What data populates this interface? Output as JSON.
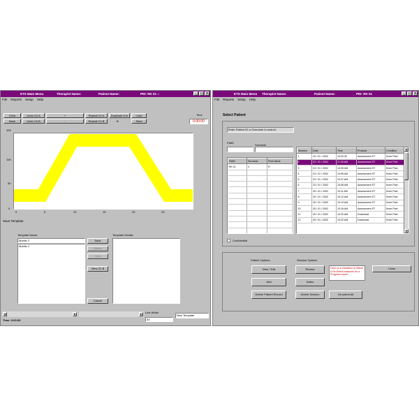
{
  "left_window": {
    "title": "ETS Main Menu",
    "therapist_label": "Therapist Name:",
    "patient_label": "Patient Name:",
    "pid_label": "PID: RK 01 ::",
    "menu": [
      "File",
      "Reports",
      "Setup",
      "Help"
    ],
    "toolbar": {
      "clear": "Clear",
      "undo_cha": "Undo Ch A",
      "plus": "+",
      "repeat_cha": "Repeat Ch A",
      "duplicate": "Duplicate A to",
      "load": "Load",
      "back": "Back",
      "undo_chb": "Undo Ch B",
      "minus": "-",
      "repeat_chb": "Repeat Ch B",
      "dup_target": "B",
      "save": "Save"
    },
    "time_label": "Time",
    "time_value": "0:00:00",
    "chart": {
      "y_ticks": [
        "100",
        "50",
        "0"
      ],
      "x_ticks": [
        "0",
        "5",
        "10",
        "15",
        "20",
        "25"
      ],
      "corner_label": "100",
      "bottom_label": "0"
    },
    "save_template": {
      "title": "Save Template",
      "name_label": "Template Name:",
      "name_value": "Mobile 2",
      "templates": [
        "Mobile 1"
      ],
      "details_label": "Template Details",
      "buttons": [
        "Save",
        "Delete",
        "Clear",
        "View Ch B",
        "Cancel"
      ]
    },
    "status": {
      "time": "Time: 0:00:30",
      "line_width_label": "Line Width",
      "line_width_value": "30",
      "new_template": "New Template"
    }
  },
  "right_window": {
    "title": "ETS Main Menu",
    "therapist_label": "Therapist Name:",
    "patient_label": "Patient Name:",
    "pid_label": "PID: RK 01",
    "menu": [
      "File",
      "Reports",
      "Setup",
      "Help"
    ],
    "section_title": "Select Patient",
    "search_hint": "Enter Patient ID or Surname to search:",
    "patid_label": "PatID",
    "surname_label": "Surname",
    "patient_columns": [
      "PatID",
      "Surname",
      "First Name"
    ],
    "patient_rows": [
      [
        "RK 01",
        "V",
        "R"
      ]
    ],
    "session_columns": [
      "Session",
      "Date",
      "Time",
      "Protocol",
      "Condition"
    ],
    "sessions": [
      [
        "1",
        "19 / 01 / 2002",
        "10:02:32",
        "Assessment ST",
        "Knee Pain"
      ],
      [
        "2",
        "23 / 01 / 2002",
        "11:03:AM",
        "Assessment ST",
        "Knee Pain"
      ],
      [
        "3",
        "23 / 01 / 2002",
        "10:05 AM",
        "Assessment ST",
        "Knee Pain"
      ],
      [
        "4",
        "23 / 01 / 2002",
        "10:06 AM",
        "Assessment ST",
        "Knee Pain"
      ],
      [
        "5",
        "23 / 01 / 2002",
        "10:07 AM",
        "Assessment ST",
        "Knee Pain"
      ],
      [
        "6",
        "23 / 01 / 2002",
        "10:08 AM",
        "Assessment ST",
        "Knee Pain"
      ],
      [
        "7",
        "25 / 01 / 2002",
        "10:11 AM",
        "Assessment ST",
        "Knee Pain"
      ],
      [
        "8",
        "25 / 01 / 2002",
        "10:12 AM",
        "Assessment ST",
        "Knee Pain"
      ],
      [
        "9",
        "25 / 01 / 2002",
        "10:13 AM",
        "Assessment ST",
        "Knee Pain"
      ],
      [
        "10",
        "25 / 01 / 2002",
        "10:16 AM",
        "Assessment ST",
        "Knee Pain"
      ],
      [
        "11",
        "25 / 01 / 2002",
        "10:22 AM",
        "Download",
        "Knee Pain"
      ],
      [
        "12",
        "25 / 01 / 2002",
        "10:22 AM",
        "Download",
        "Knee Pain"
      ]
    ],
    "confidential": "Confidential",
    "patient_options": {
      "title": "Patient Options",
      "buttons": [
        "View / Edit",
        "Add",
        "Delete Patient Record"
      ]
    },
    "session_options": {
      "title": "Session Options",
      "buttons": [
        "Review",
        "Notes",
        "Delete Session",
        "De-select All"
      ],
      "note": "Click on a checkbox to Select a De-Select sessions for a Progress report"
    },
    "close": "Close"
  },
  "colors": {
    "titlebar": "#7a0a7a",
    "window": "#c0c0c0",
    "trace": "#ffff00",
    "time_text": "#d00000"
  }
}
